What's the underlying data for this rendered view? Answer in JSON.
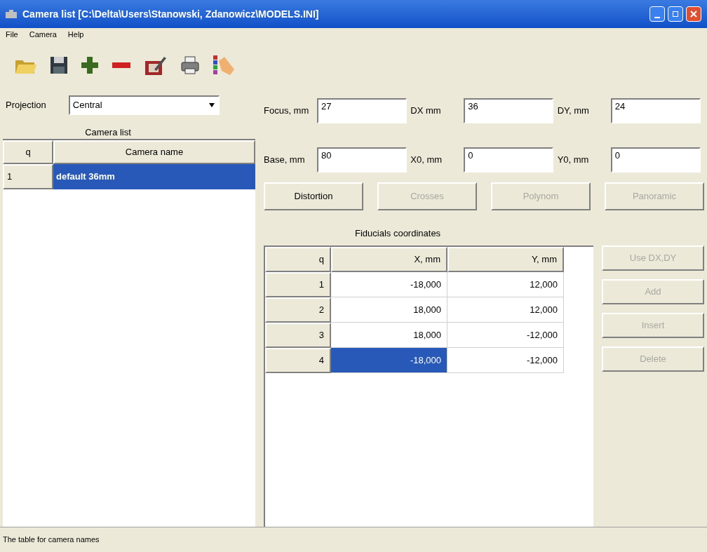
{
  "window": {
    "title": "Camera list [C:\\Delta\\Users\\Stanowski, Zdanowicz\\MODELS.INI]"
  },
  "menu": [
    "File",
    "Camera",
    "Help"
  ],
  "toolbar": [
    {
      "kind": "open"
    },
    {
      "kind": "save"
    },
    {
      "kind": "add"
    },
    {
      "kind": "remove"
    },
    {
      "kind": "edit"
    },
    {
      "kind": "print"
    },
    {
      "kind": "pointer"
    }
  ],
  "projection": {
    "label": "Projection",
    "value": "Central"
  },
  "camera_list": {
    "title": "Camera list",
    "columns": [
      "q",
      "Camera name"
    ],
    "rows": [
      {
        "cells": [
          "1",
          "default 36mm"
        ],
        "selected": true
      }
    ]
  },
  "fields": [
    {
      "label": "Focus, mm",
      "value": "27"
    },
    {
      "label": "DX mm",
      "value": "36"
    },
    {
      "label": "DY, mm",
      "value": "24"
    },
    {
      "label": "Base, mm",
      "value": "80"
    },
    {
      "label": "X0, mm",
      "value": "0"
    },
    {
      "label": "Y0, mm",
      "value": "0"
    }
  ],
  "mode_buttons": [
    {
      "label": "Distortion",
      "disabled": false
    },
    {
      "label": "Crosses",
      "disabled": true
    },
    {
      "label": "Polynom",
      "disabled": true
    },
    {
      "label": "Panoramic",
      "disabled": true
    }
  ],
  "fiducials": {
    "title": "Fiducials coordinates",
    "columns": [
      "q",
      "X, mm",
      "Y, mm"
    ],
    "rows": [
      {
        "cells": [
          {
            "text": "1",
            "selected": false
          },
          {
            "text": "-18,000",
            "selected": false
          },
          {
            "text": "12,000",
            "selected": false
          }
        ]
      },
      {
        "cells": [
          {
            "text": "2",
            "selected": false
          },
          {
            "text": "18,000",
            "selected": false
          },
          {
            "text": "12,000",
            "selected": false
          }
        ]
      },
      {
        "cells": [
          {
            "text": "3",
            "selected": false
          },
          {
            "text": "18,000",
            "selected": false
          },
          {
            "text": "-12,000",
            "selected": false
          }
        ]
      },
      {
        "cells": [
          {
            "text": "4",
            "selected": false
          },
          {
            "text": "-18,000",
            "selected": true
          },
          {
            "text": "-12,000",
            "selected": false
          }
        ]
      }
    ]
  },
  "side_buttons": [
    {
      "label": "Use DX,DY",
      "disabled": true
    },
    {
      "label": "Add",
      "disabled": true
    },
    {
      "label": "Insert",
      "disabled": true
    },
    {
      "label": "Delete",
      "disabled": true
    }
  ],
  "status_bar": "The table for camera names"
}
